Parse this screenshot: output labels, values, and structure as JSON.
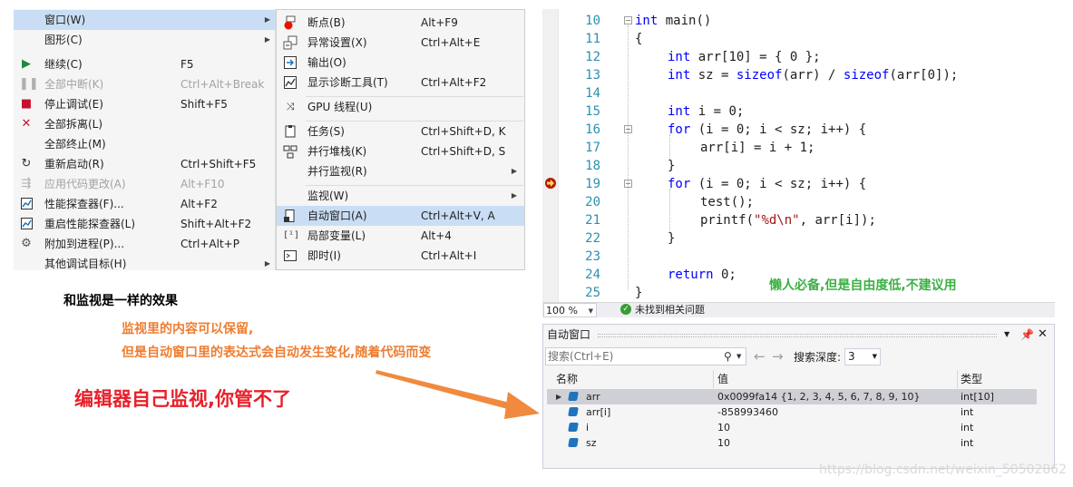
{
  "debug_menu": {
    "items": [
      {
        "label": "窗口(W)",
        "shortcut": "",
        "icon": "",
        "submenu": true,
        "highlighted": true,
        "disabled": false
      },
      {
        "label": "图形(C)",
        "shortcut": "",
        "icon": "",
        "submenu": true,
        "highlighted": false,
        "disabled": false
      },
      {
        "label": "继续(C)",
        "shortcut": "F5",
        "icon": "play-icon",
        "submenu": false,
        "highlighted": false,
        "disabled": false
      },
      {
        "label": "全部中断(K)",
        "shortcut": "Ctrl+Alt+Break",
        "icon": "pause-icon",
        "submenu": false,
        "highlighted": false,
        "disabled": true
      },
      {
        "label": "停止调试(E)",
        "shortcut": "Shift+F5",
        "icon": "stop-icon",
        "submenu": false,
        "highlighted": false,
        "disabled": false
      },
      {
        "label": "全部拆离(L)",
        "shortcut": "",
        "icon": "detach-x-icon",
        "submenu": false,
        "highlighted": false,
        "disabled": false
      },
      {
        "label": "全部终止(M)",
        "shortcut": "",
        "icon": "",
        "submenu": false,
        "highlighted": false,
        "disabled": false
      },
      {
        "label": "重新启动(R)",
        "shortcut": "Ctrl+Shift+F5",
        "icon": "restart-icon",
        "submenu": false,
        "highlighted": false,
        "disabled": false
      },
      {
        "label": "应用代码更改(A)",
        "shortcut": "Alt+F10",
        "icon": "apply-code-icon",
        "submenu": false,
        "highlighted": false,
        "disabled": true
      },
      {
        "label": "性能探查器(F)...",
        "shortcut": "Alt+F2",
        "icon": "profiler-icon",
        "submenu": false,
        "highlighted": false,
        "disabled": false
      },
      {
        "label": "重启性能探查器(L)",
        "shortcut": "Shift+Alt+F2",
        "icon": "profiler-icon",
        "submenu": false,
        "highlighted": false,
        "disabled": false
      },
      {
        "label": "附加到进程(P)...",
        "shortcut": "Ctrl+Alt+P",
        "icon": "attach-gear-icon",
        "submenu": false,
        "highlighted": false,
        "disabled": false
      },
      {
        "label": "其他调试目标(H)",
        "shortcut": "",
        "icon": "",
        "submenu": true,
        "highlighted": false,
        "disabled": false
      }
    ]
  },
  "window_submenu": {
    "items": [
      {
        "label": "断点(B)",
        "shortcut": "Alt+F9",
        "icon": "breakpoint-icon",
        "submenu": false,
        "highlighted": false
      },
      {
        "label": "异常设置(X)",
        "shortcut": "Ctrl+Alt+E",
        "icon": "exception-settings-icon",
        "submenu": false,
        "highlighted": false
      },
      {
        "label": "输出(O)",
        "shortcut": "",
        "icon": "output-icon",
        "submenu": false,
        "highlighted": false
      },
      {
        "label": "显示诊断工具(T)",
        "shortcut": "Ctrl+Alt+F2",
        "icon": "diagnostics-icon",
        "submenu": false,
        "highlighted": false
      },
      {
        "label": "GPU 线程(U)",
        "shortcut": "",
        "icon": "gpu-threads-icon",
        "submenu": false,
        "highlighted": false
      },
      {
        "label": "任务(S)",
        "shortcut": "Ctrl+Shift+D, K",
        "icon": "tasks-icon",
        "submenu": false,
        "highlighted": false
      },
      {
        "label": "并行堆栈(K)",
        "shortcut": "Ctrl+Shift+D, S",
        "icon": "parallel-stacks-icon",
        "submenu": false,
        "highlighted": false
      },
      {
        "label": "并行监视(R)",
        "shortcut": "",
        "icon": "",
        "submenu": true,
        "highlighted": false
      },
      {
        "label": "监视(W)",
        "shortcut": "",
        "icon": "",
        "submenu": true,
        "highlighted": false
      },
      {
        "label": "自动窗口(A)",
        "shortcut": "Ctrl+Alt+V, A",
        "icon": "autos-icon",
        "submenu": false,
        "highlighted": true
      },
      {
        "label": "局部变量(L)",
        "shortcut": "Alt+4",
        "icon": "locals-icon",
        "submenu": false,
        "highlighted": false
      },
      {
        "label": "即时(I)",
        "shortcut": "Ctrl+Alt+I",
        "icon": "immediate-icon",
        "submenu": false,
        "highlighted": false
      }
    ]
  },
  "annotations": {
    "same_effect": "和监视是一样的效果",
    "watch_keeps_line1": "监视里的内容可以保留,",
    "watch_keeps_line2": "但是自动窗口里的表达式会自动发生变化,随着代码而变",
    "editor_watches": "编辑器自己监视,你管不了",
    "lazy_note": "懒人必备,但是自由度低,不建议用"
  },
  "editor": {
    "line_numbers": [
      "10",
      "11",
      "12",
      "13",
      "14",
      "15",
      "16",
      "17",
      "18",
      "19",
      "20",
      "21",
      "22",
      "23",
      "24",
      "25"
    ],
    "current_line": "19",
    "zoom": "100 %",
    "status": "未找到相关问题",
    "code": {
      "l10_a": "int",
      "l10_b": " main()",
      "l11": "{",
      "l12_a": "int",
      "l12_b": " arr[10] = { 0 };",
      "l13_a": "int",
      "l13_b": " sz = ",
      "l13_c": "sizeof",
      "l13_d": "(arr) / ",
      "l13_e": "sizeof",
      "l13_f": "(arr[0]);",
      "l15_a": "int",
      "l15_b": " i = 0;",
      "l16_a": "for",
      "l16_b": " (i = 0; i < sz; i++) {",
      "l17": "arr[i] = i + 1;",
      "l18": "}",
      "l19_a": "for",
      "l19_b": " (i = 0; i < sz; i++) {",
      "l20": "test();",
      "l21_a": "printf(",
      "l21_b": "\"%d\\n\"",
      "l21_c": ", arr[i]);",
      "l22": "}",
      "l24_a": "return",
      "l24_b": " 0;",
      "l25": "}"
    }
  },
  "autos_window": {
    "title": "自动窗口",
    "search_placeholder": "搜索(Ctrl+E)",
    "search_depth_label": "搜索深度:",
    "search_depth_value": "3",
    "columns": {
      "name": "名称",
      "value": "值",
      "type": "类型"
    },
    "rows": [
      {
        "name": "arr",
        "value": "0x0099fa14 {1, 2, 3, 4, 5, 6, 7, 8, 9, 10}",
        "type": "int[10]",
        "expandable": true,
        "selected": true
      },
      {
        "name": "arr[i]",
        "value": "-858993460",
        "type": "int",
        "expandable": false,
        "selected": false
      },
      {
        "name": "i",
        "value": "10",
        "type": "int",
        "expandable": false,
        "selected": false
      },
      {
        "name": "sz",
        "value": "10",
        "type": "int",
        "expandable": false,
        "selected": false
      }
    ]
  },
  "watermark": "https://blog.csdn.net/weixin_50502862",
  "colors": {
    "menu_highlight": "#c9def5",
    "keyword": "#0000ff",
    "string": "#a31515",
    "line_number": "#2b91af",
    "annotation_orange": "#ee7d31",
    "annotation_red": "#e8202a",
    "annotation_green": "#3cb045",
    "arrow": "#f08a3e"
  }
}
